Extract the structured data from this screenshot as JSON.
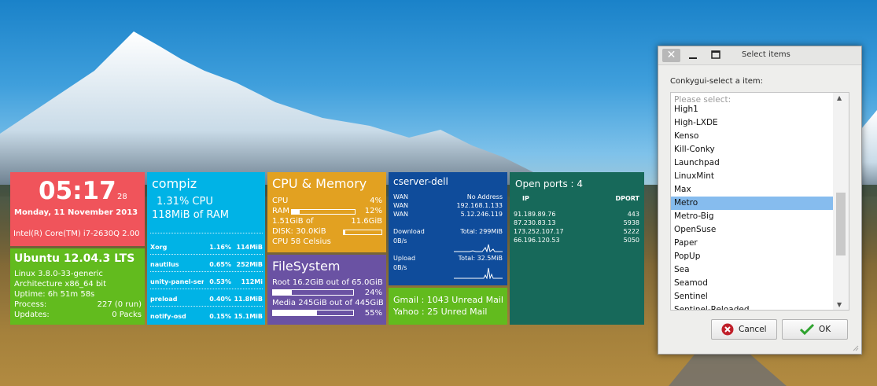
{
  "clock": {
    "time": "05:17",
    "seconds": "28",
    "date": "Monday,  11 November 2013",
    "cpu_model": "Intel(R) Core(TM) i7-2630Q 2.00"
  },
  "ubuntu": {
    "title": "Ubuntu 12.04.3 LTS",
    "kernel": "Linux 3.8.0-33-generic",
    "arch": "Architecture x86_64 bit",
    "uptime": "Uptime: 6h 51m 58s",
    "process_label": "Process:",
    "process_value": "227 (0 run)",
    "updates_label": "Updates:",
    "updates_value": "0 Packs"
  },
  "compiz": {
    "title": "compiz",
    "cpu": "1.31% CPU",
    "ram": "118MiB of RAM",
    "processes": [
      {
        "name": "Xorg",
        "cpu": "1.16%",
        "mem": "114MiB"
      },
      {
        "name": "nautilus",
        "cpu": "0.65%",
        "mem": "252MiB"
      },
      {
        "name": "unity-panel-ser",
        "cpu": "0.53%",
        "mem": "112Mi"
      },
      {
        "name": "preload",
        "cpu": "0.40%",
        "mem": "11.8MiB"
      },
      {
        "name": "notify-osd",
        "cpu": "0.15%",
        "mem": "15.1MiB"
      }
    ]
  },
  "cpumem": {
    "title": "CPU & Memory",
    "cpu_label": "CPU",
    "cpu_value": "4%",
    "cpu_fraction": 0.04,
    "ram_label": "RAM",
    "ram_value": "12%",
    "ram_fraction": 0.12,
    "mem_used": "1.51GiB of",
    "mem_total": "11.6GiB",
    "disk": "DISK: 30.0KiB",
    "disk_fraction": 0.05,
    "temp": "CPU 58 Celsius"
  },
  "filesystem": {
    "title": "FileSystem",
    "root": "Root 16.2GiB out of 65.0GiB",
    "root_pct": "24%",
    "root_fraction": 0.24,
    "media": "Media 245GiB out of 445GiB",
    "media_pct": "55%",
    "media_fraction": 0.55
  },
  "network": {
    "title": "cserver-dell",
    "wan": [
      {
        "label": "WAN",
        "value": "No Address"
      },
      {
        "label": "WAN",
        "value": "192.168.1.133"
      },
      {
        "label": "WAN",
        "value": "5.12.246.119"
      }
    ],
    "download_label": "Download",
    "download_total": "Total: 299MiB",
    "download_rate": "0B/s",
    "upload_label": "Upload",
    "upload_total": "Total: 32.5MiB",
    "upload_rate": "0B/s"
  },
  "mail": {
    "gmail": "Gmail : 1043 Unread Mail",
    "yahoo": "Yahoo : 25 Unred Mail"
  },
  "ports": {
    "title": "Open ports : 4",
    "ip_header": "IP",
    "port_header": "DPORT",
    "rows": [
      {
        "ip": "91.189.89.76",
        "port": "443"
      },
      {
        "ip": "87.230.83.13",
        "port": "5938"
      },
      {
        "ip": "173.252.107.17",
        "port": "5222"
      },
      {
        "ip": "66.196.120.53",
        "port": "5050"
      }
    ]
  },
  "dialog": {
    "window_title": "Select items",
    "prompt": "Conkygui-select a item:",
    "placeholder": "Please select:",
    "items": [
      "High1",
      "High-LXDE",
      "Kenso",
      "Kill-Conky",
      "Launchpad",
      "LinuxMint",
      "Max",
      "Metro",
      "Metro-Big",
      "OpenSuse",
      "Paper",
      "PopUp",
      "Sea",
      "Seamod",
      "Sentinel",
      "Sentinel-Reloaded"
    ],
    "selected": "Metro",
    "cancel_label": "Cancel",
    "ok_label": "OK"
  },
  "colors": {
    "clock": "#f0545b",
    "ubuntu": "#62bb1e",
    "compiz": "#00b3e6",
    "cpumem": "#e2a121",
    "filesystem": "#6a52a3",
    "network": "#0f4c9b",
    "mail": "#62bb1e",
    "ports": "#17695a",
    "selection": "#86bcee"
  }
}
